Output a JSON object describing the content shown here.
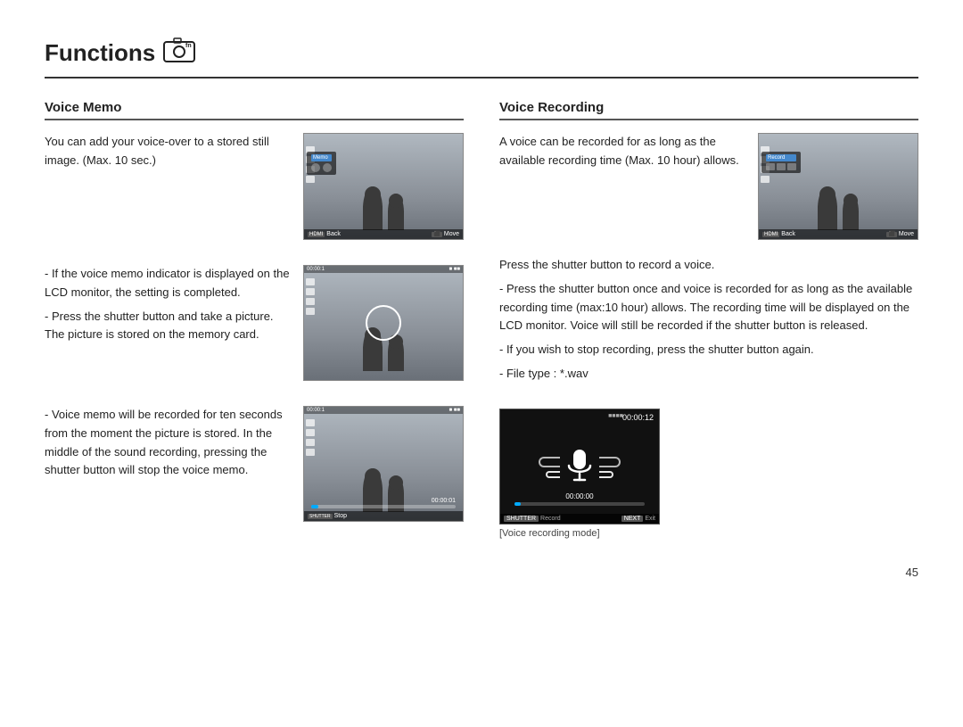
{
  "title": "Functions",
  "title_icon": "📷",
  "left_column": {
    "section_title": "Voice Memo",
    "intro_text": "You can add your voice-over to a stored still image. (Max. 10 sec.)",
    "bullet1": "- If the voice memo indicator is displayed on the LCD monitor, the setting is completed.",
    "bullet2": "- Press the shutter button and take a picture. The picture is stored on the memory card.",
    "bullet3": "- Voice memo will be recorded for ten seconds from the moment the picture is stored. In the middle of the sound recording, pressing the shutter button will stop the voice memo.",
    "img1_bottom_left": "Back",
    "img1_bottom_right": "Move",
    "img2_time": "00:00:1",
    "img3_time": "00:00:1",
    "img3_timer": "00:00:01",
    "img3_bottom": "Stop"
  },
  "right_column": {
    "section_title": "Voice Recording",
    "intro_text": "A voice can be recorded for as long as the available recording time (Max. 10 hour) allows.",
    "bullet1": "Press the shutter button to record a voice.",
    "bullet2": "- Press the shutter button once and voice is recorded for as long as the available recording time (max:10 hour) allows. The recording time will be displayed on the LCD monitor. Voice will still be recorded if the shutter button is released.",
    "bullet3": "- If you wish to stop recording, press the shutter button again.",
    "bullet4": "- File type : *.wav",
    "img1_bottom_left": "Back",
    "img1_bottom_right": "Move",
    "voice_timer": "00:00:12",
    "voice_rec_time": "00:00:00",
    "voice_bottom_record": "Record",
    "voice_bottom_exit": "Exit",
    "caption": "[Voice recording mode]"
  },
  "page_number": "45"
}
